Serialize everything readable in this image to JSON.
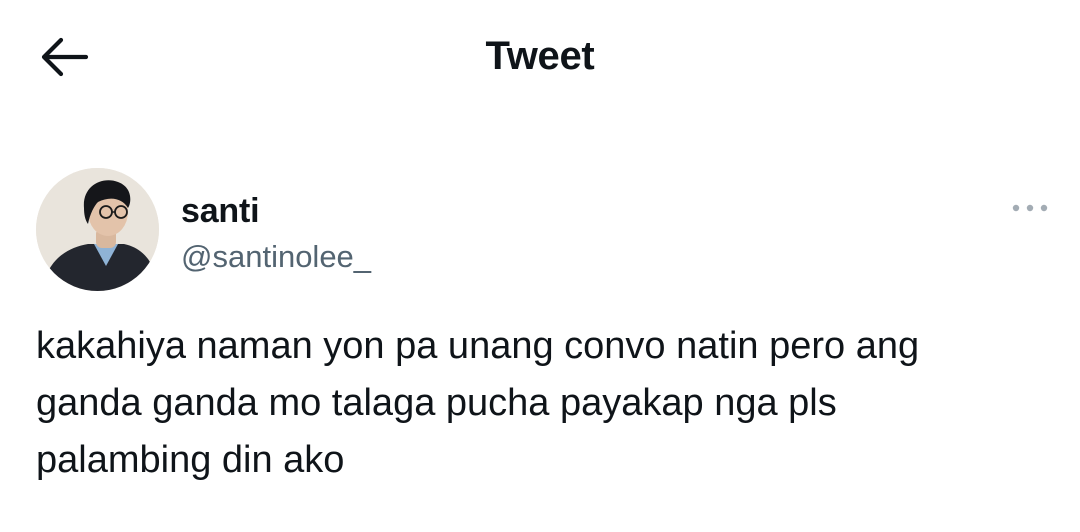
{
  "header": {
    "title": "Tweet",
    "back_icon": "arrow-left-icon"
  },
  "tweet": {
    "author": {
      "display_name": "santi",
      "handle": "@santinolee_",
      "avatar": "profile-photo"
    },
    "more_icon": "more-horizontal-icon",
    "text": "kakahiya naman yon pa unang convo natin pero ang\nganda ganda mo talaga pucha payakap nga pls\npalambing din ako"
  },
  "colors": {
    "text_primary": "#0f1419",
    "text_secondary": "#536471",
    "background": "#ffffff"
  }
}
